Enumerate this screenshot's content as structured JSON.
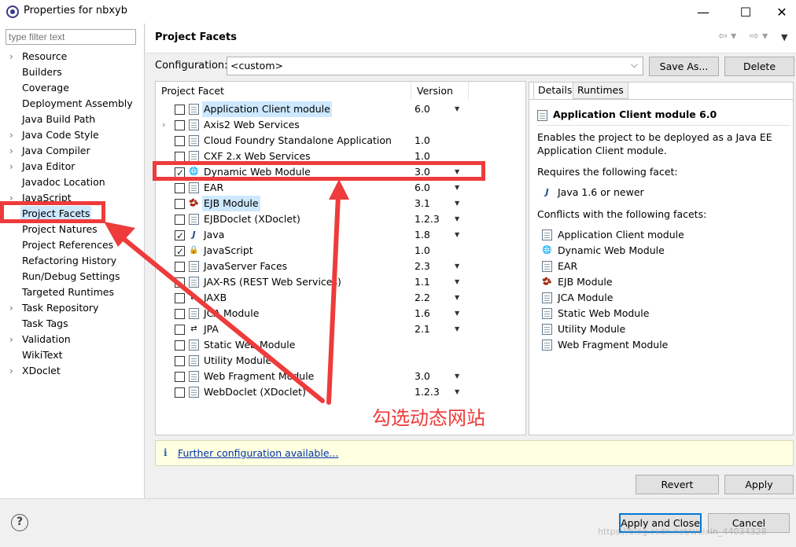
{
  "window": {
    "title": "Properties for nbxyb",
    "controls": [
      "—",
      "☐",
      "✕"
    ]
  },
  "left_panel": {
    "filter_placeholder": "type filter text",
    "items": [
      {
        "label": "Resource",
        "expandable": true
      },
      {
        "label": "Builders",
        "expandable": false
      },
      {
        "label": "Coverage",
        "expandable": false
      },
      {
        "label": "Deployment Assembly",
        "expandable": false
      },
      {
        "label": "Java Build Path",
        "expandable": false
      },
      {
        "label": "Java Code Style",
        "expandable": true
      },
      {
        "label": "Java Compiler",
        "expandable": true
      },
      {
        "label": "Java Editor",
        "expandable": true
      },
      {
        "label": "Javadoc Location",
        "expandable": false
      },
      {
        "label": "JavaScript",
        "expandable": true
      },
      {
        "label": "Project Facets",
        "expandable": false,
        "selected": true
      },
      {
        "label": "Project Natures",
        "expandable": false
      },
      {
        "label": "Project References",
        "expandable": false
      },
      {
        "label": "Refactoring History",
        "expandable": false
      },
      {
        "label": "Run/Debug Settings",
        "expandable": false
      },
      {
        "label": "Targeted Runtimes",
        "expandable": false
      },
      {
        "label": "Task Repository",
        "expandable": true
      },
      {
        "label": "Task Tags",
        "expandable": false
      },
      {
        "label": "Validation",
        "expandable": true
      },
      {
        "label": "WikiText",
        "expandable": false
      },
      {
        "label": "XDoclet",
        "expandable": true
      }
    ]
  },
  "header": {
    "title": "Project Facets",
    "nav_icons": [
      "back-arrow-icon",
      "forward-arrow-icon",
      "view-menu-icon"
    ]
  },
  "configuration": {
    "label": "Configuration:",
    "value": "<custom>",
    "save_as_label": "Save As...",
    "delete_label": "Delete"
  },
  "facets": {
    "col_facet": "Project Facet",
    "col_version": "Version",
    "rows": [
      {
        "name": "Application Client module",
        "version": "6.0",
        "checked": false,
        "dropdown": true,
        "icon": "page",
        "highlight": true,
        "expandable": false
      },
      {
        "name": "Axis2 Web Services",
        "version": "",
        "checked": false,
        "dropdown": false,
        "icon": "page",
        "highlight": false,
        "expandable": true
      },
      {
        "name": "Cloud Foundry Standalone Application",
        "version": "1.0",
        "checked": false,
        "dropdown": false,
        "icon": "page",
        "highlight": false,
        "expandable": false
      },
      {
        "name": "CXF 2.x Web Services",
        "version": "1.0",
        "checked": false,
        "dropdown": false,
        "icon": "page",
        "highlight": false,
        "expandable": false
      },
      {
        "name": "Dynamic Web Module",
        "version": "3.0",
        "checked": true,
        "dropdown": true,
        "icon": "globe",
        "highlight": false,
        "expandable": false
      },
      {
        "name": "EAR",
        "version": "6.0",
        "checked": false,
        "dropdown": true,
        "icon": "page",
        "highlight": false,
        "expandable": false
      },
      {
        "name": "EJB Module",
        "version": "3.1",
        "checked": false,
        "dropdown": true,
        "icon": "bean",
        "highlight": true,
        "expandable": false
      },
      {
        "name": "EJBDoclet (XDoclet)",
        "version": "1.2.3",
        "checked": false,
        "dropdown": true,
        "icon": "page",
        "highlight": false,
        "expandable": false
      },
      {
        "name": "Java",
        "version": "1.8",
        "checked": true,
        "dropdown": true,
        "icon": "java",
        "highlight": false,
        "expandable": false
      },
      {
        "name": "JavaScript",
        "version": "1.0",
        "checked": true,
        "dropdown": false,
        "icon": "lock",
        "highlight": false,
        "expandable": false
      },
      {
        "name": "JavaServer Faces",
        "version": "2.3",
        "checked": false,
        "dropdown": true,
        "icon": "page",
        "highlight": false,
        "expandable": false
      },
      {
        "name": "JAX-RS (REST Web Services)",
        "version": "1.1",
        "checked": false,
        "dropdown": true,
        "icon": "page",
        "highlight": false,
        "expandable": false
      },
      {
        "name": "JAXB",
        "version": "2.2",
        "checked": false,
        "dropdown": true,
        "icon": "arrows",
        "highlight": false,
        "expandable": false
      },
      {
        "name": "JCA Module",
        "version": "1.6",
        "checked": false,
        "dropdown": true,
        "icon": "page",
        "highlight": false,
        "expandable": false
      },
      {
        "name": "JPA",
        "version": "2.1",
        "checked": false,
        "dropdown": true,
        "icon": "arrows",
        "highlight": false,
        "expandable": false
      },
      {
        "name": "Static Web Module",
        "version": "",
        "checked": false,
        "dropdown": false,
        "icon": "page",
        "highlight": false,
        "expandable": false
      },
      {
        "name": "Utility Module",
        "version": "",
        "checked": false,
        "dropdown": false,
        "icon": "page",
        "highlight": false,
        "expandable": false
      },
      {
        "name": "Web Fragment Module",
        "version": "3.0",
        "checked": false,
        "dropdown": true,
        "icon": "page",
        "highlight": false,
        "expandable": false
      },
      {
        "name": "WebDoclet (XDoclet)",
        "version": "1.2.3",
        "checked": false,
        "dropdown": true,
        "icon": "page",
        "highlight": false,
        "expandable": false
      }
    ]
  },
  "details": {
    "tab_details": "Details",
    "tab_runtimes": "Runtimes",
    "title": "Application Client module 6.0",
    "description": "Enables the project to be deployed as a Java EE Application Client module.",
    "requires_label": "Requires the following facet:",
    "requires": [
      {
        "name": "Java 1.6 or newer",
        "icon": "java"
      }
    ],
    "conflicts_label": "Conflicts with the following facets:",
    "conflicts": [
      {
        "name": "Application Client module",
        "icon": "page"
      },
      {
        "name": "Dynamic Web Module",
        "icon": "globe"
      },
      {
        "name": "EAR",
        "icon": "page"
      },
      {
        "name": "EJB Module",
        "icon": "bean"
      },
      {
        "name": "JCA Module",
        "icon": "page"
      },
      {
        "name": "Static Web Module",
        "icon": "page"
      },
      {
        "name": "Utility Module",
        "icon": "page"
      },
      {
        "name": "Web Fragment Module",
        "icon": "page"
      }
    ]
  },
  "info_bar": {
    "icon": "i",
    "link": "Further configuration available..."
  },
  "buttons": {
    "revert": "Revert",
    "apply": "Apply",
    "apply_close": "Apply and Close",
    "cancel": "Cancel"
  },
  "annotation": {
    "text": "勾选动态网站",
    "color": "#ee3b3b"
  },
  "watermark": "https://blog.csdn.net/weixin_44034328"
}
